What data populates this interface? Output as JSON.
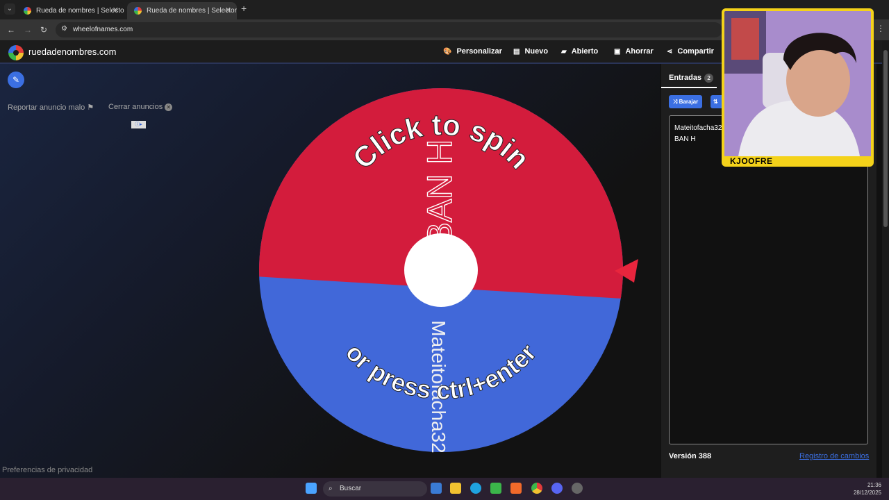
{
  "browser": {
    "tab1_title": "Rueda de nombres | Selector de",
    "tab2_title": "Rueda de nombres | Selector de",
    "url": "wheelofnames.com"
  },
  "site": {
    "name": "ruedadenombres.com",
    "nav": {
      "personalizar": "Personalizar",
      "nuevo": "Nuevo",
      "abierto": "Abierto",
      "ahorrar": "Ahorrar",
      "compartir": "Compartir"
    }
  },
  "ads": {
    "report": "Reportar anuncio malo",
    "close": "Cerrar anuncios"
  },
  "footer": {
    "privacy": "Preferencias de privacidad"
  },
  "wheel": {
    "click_text": "Click to spin",
    "press_text": "or press ctrl+enter",
    "segment_top": "BAN H",
    "segment_bottom": "Mateitofacha32",
    "colors": {
      "top": "#d31c3c",
      "bottom": "#4168d9"
    }
  },
  "panel": {
    "tab_label": "Entradas",
    "count": "2",
    "shuffle_label": "Barajar",
    "entries": [
      "Mateitofacha32",
      "BAN H"
    ],
    "version": "Versión 388",
    "changelog": "Registro de cambios"
  },
  "webcam": {
    "label": "KJOOFRE"
  },
  "taskbar": {
    "search": "Buscar",
    "time": "21:36",
    "date": "28/12/2025"
  }
}
